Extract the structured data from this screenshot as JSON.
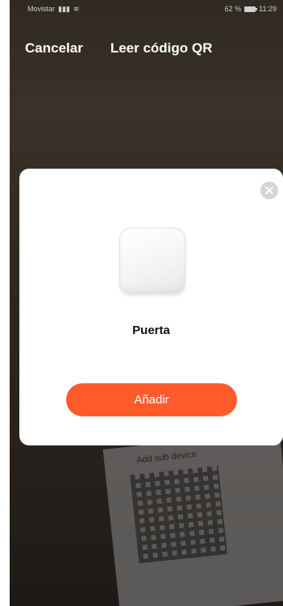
{
  "status_bar": {
    "carrier": "Movistar",
    "battery": "62 %",
    "time": "11:29"
  },
  "nav": {
    "cancel_label": "Cancelar",
    "title": "Leer código QR"
  },
  "background": {
    "paper_title": "Add sub device"
  },
  "modal": {
    "device_name": "Puerta",
    "add_label": "Añadir",
    "accent_color": "#ff5b2a"
  },
  "icons": [
    "signal-icon",
    "wifi-icon",
    "battery-icon",
    "close-icon",
    "device-icon"
  ]
}
